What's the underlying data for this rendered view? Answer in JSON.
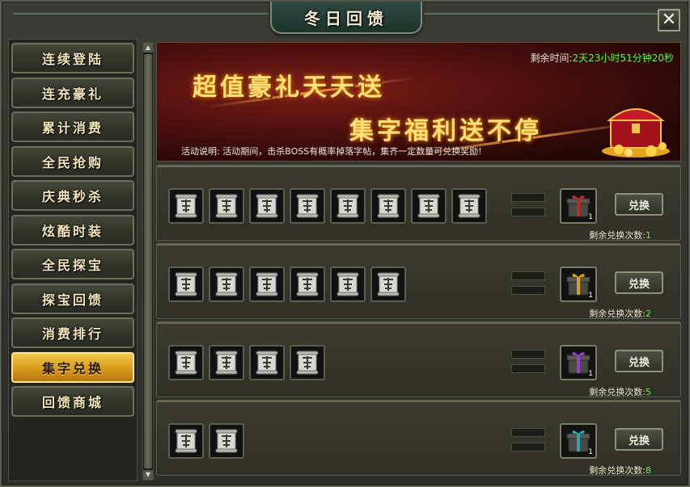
{
  "window": {
    "title": "冬日回馈",
    "close_label": "✕"
  },
  "sidebar": {
    "items": [
      {
        "label": "连续登陆",
        "active": false
      },
      {
        "label": "连充豪礼",
        "active": false
      },
      {
        "label": "累计消费",
        "active": false
      },
      {
        "label": "全民抢购",
        "active": false
      },
      {
        "label": "庆典秒杀",
        "active": false
      },
      {
        "label": "炫酷时装",
        "active": false
      },
      {
        "label": "全民探宝",
        "active": false
      },
      {
        "label": "探宝回馈",
        "active": false
      },
      {
        "label": "消费排行",
        "active": false
      },
      {
        "label": "集字兑换",
        "active": true
      },
      {
        "label": "回馈商城",
        "active": false
      }
    ]
  },
  "banner": {
    "headline1": "超值豪礼天天送",
    "headline2": "集字福利送不停",
    "timer_label": "剩余时间:",
    "timer_value": "2天23小时51分钟20秒",
    "desc_label": "活动说明:",
    "desc_text": "活动期间，击杀BOSS有概率掉落字帖，集齐一定数量可兑换奖励!"
  },
  "rows": [
    {
      "chars": [
        "字",
        "字",
        "字",
        "字",
        "字",
        "字",
        "字",
        "字"
      ],
      "reward_count": "1",
      "reward_color": "#c0282a",
      "button": "兑换",
      "remain_label": "剩余兑换次数:",
      "remain_value": "1"
    },
    {
      "chars": [
        "字",
        "字",
        "字",
        "字",
        "字",
        "字"
      ],
      "reward_count": "1",
      "reward_color": "#d9a012",
      "button": "兑换",
      "remain_label": "剩余兑换次数:",
      "remain_value": "2"
    },
    {
      "chars": [
        "字",
        "字",
        "字",
        "字"
      ],
      "reward_count": "1",
      "reward_color": "#9c3bd6",
      "button": "兑换",
      "remain_label": "剩余兑换次数:",
      "remain_value": "5"
    },
    {
      "chars": [
        "字",
        "字"
      ],
      "reward_count": "1",
      "reward_color": "#2aa3b8",
      "button": "兑换",
      "remain_label": "剩余兑换次数:",
      "remain_value": "8"
    }
  ],
  "icons": {
    "scroll_item": "scroll-icon",
    "reward": "gift-box-icon",
    "close": "close-icon"
  }
}
